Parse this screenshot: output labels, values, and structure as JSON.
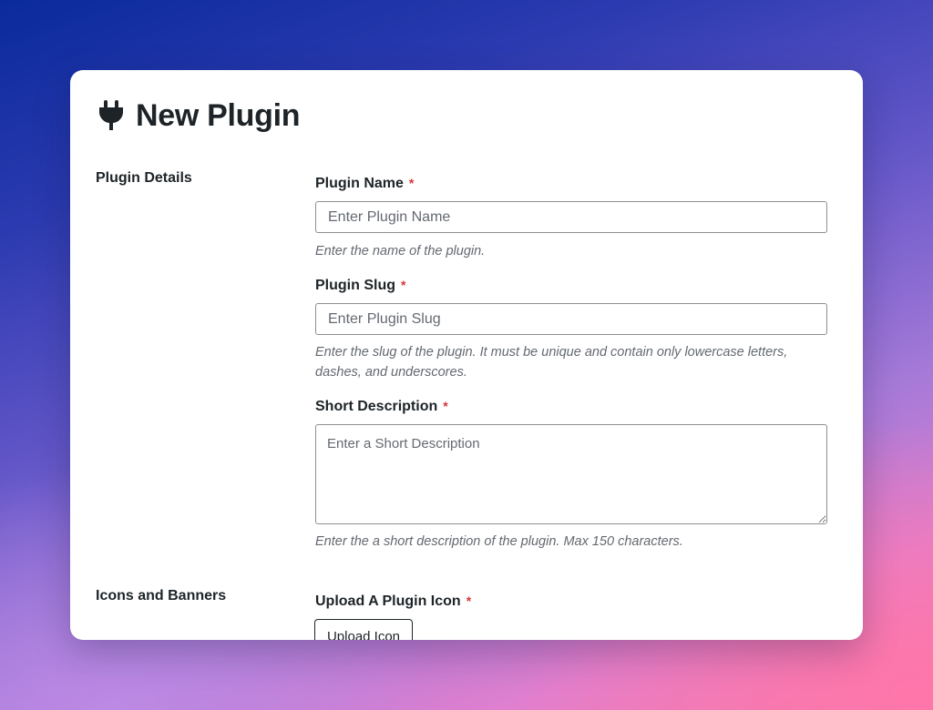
{
  "header": {
    "icon": "plug-icon",
    "title": "New Plugin"
  },
  "sections": {
    "plugin_details": {
      "label": "Plugin Details"
    },
    "icons_banners": {
      "label": "Icons and Banners"
    }
  },
  "fields": {
    "plugin_name": {
      "label": "Plugin Name",
      "required_marker": "*",
      "placeholder": "Enter Plugin Name",
      "value": "",
      "help": "Enter the name of the plugin."
    },
    "plugin_slug": {
      "label": "Plugin Slug",
      "required_marker": "*",
      "placeholder": "Enter Plugin Slug",
      "value": "",
      "help": "Enter the slug of the plugin. It must be unique and contain only lowercase letters, dashes, and underscores."
    },
    "short_description": {
      "label": "Short Description",
      "required_marker": "*",
      "placeholder": "Enter a Short Description",
      "value": "",
      "help": "Enter the a short description of the plugin. Max 150 characters."
    },
    "plugin_icon": {
      "label": "Upload A Plugin Icon",
      "required_marker": "*",
      "button_label": "Upload Icon"
    }
  },
  "colors": {
    "required": "#d63638",
    "text": "#1d2327",
    "help_text": "#646970",
    "input_border": "#8c8f94"
  }
}
